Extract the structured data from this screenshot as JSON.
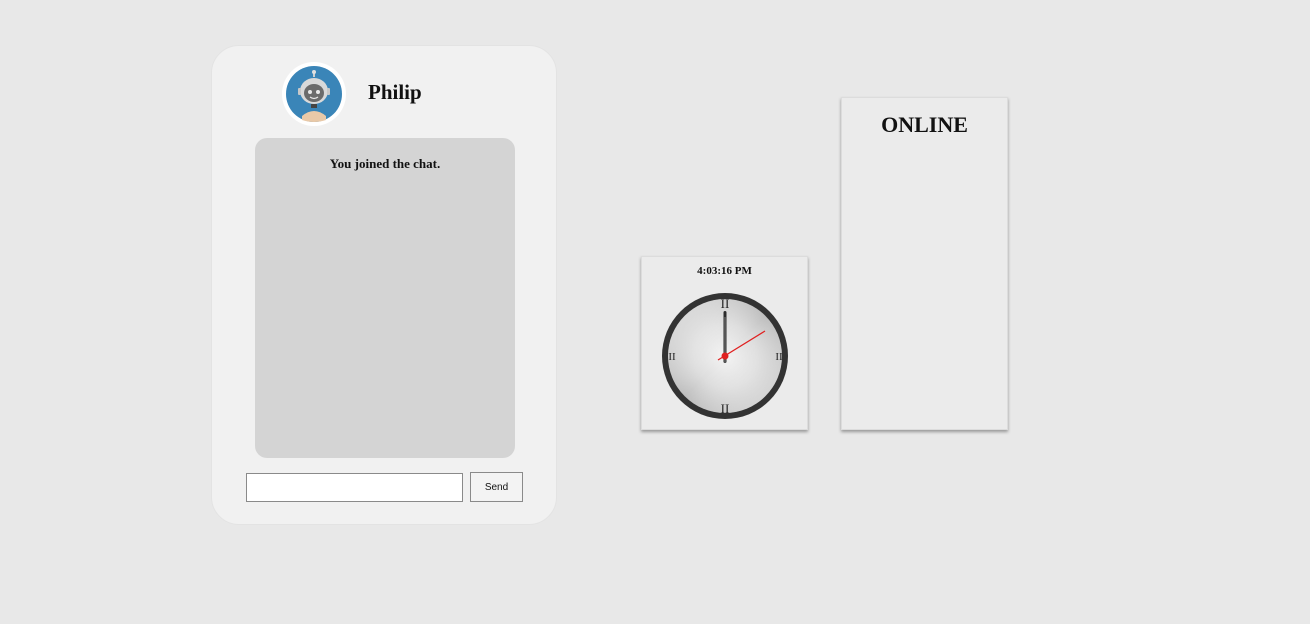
{
  "chat": {
    "user_name": "Philip",
    "avatar_icon": "robot-avatar-icon",
    "messages": [
      "You joined the chat."
    ],
    "input_value": "",
    "input_placeholder": "",
    "send_label": "Send"
  },
  "clock": {
    "digital_time": "4:03:16 PM",
    "numerals": {
      "top": "II",
      "right": "II",
      "bottom": "II",
      "left": "II"
    }
  },
  "online": {
    "title": "ONLINE",
    "users": []
  },
  "colors": {
    "page_background": "#e8e8e8",
    "avatar_background": "#3a85b8",
    "second_hand": "#e02020",
    "clock_rim": "#333333"
  }
}
